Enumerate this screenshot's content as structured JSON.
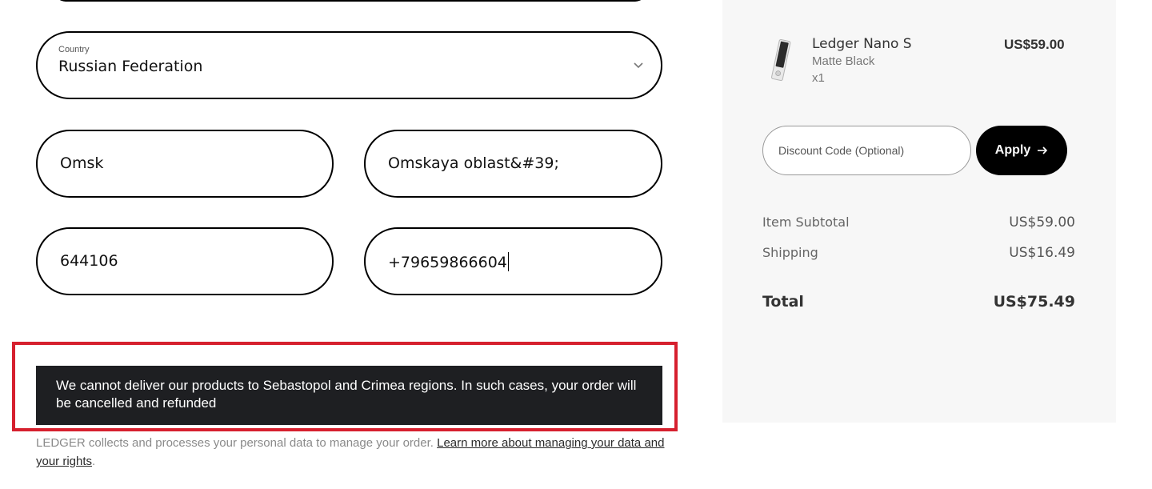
{
  "address_form": {
    "country": {
      "caption": "Country",
      "value": "Russian Federation"
    },
    "city": {
      "value": "Omsk"
    },
    "region": {
      "value": "Omskaya oblast&#39;"
    },
    "postal_code": {
      "value": "644106"
    },
    "phone": {
      "value": "+79659866604"
    }
  },
  "delivery_notice": "We cannot deliver our products to Sebastopol and Crimea regions. In such cases, your order will be cancelled and refunded",
  "privacy": {
    "text": "LEDGER collects and processes your personal data to manage your order.",
    "link_text": "Learn more about managing your data and your rights",
    "trailing": "."
  },
  "order_summary": {
    "product": {
      "name": "Ledger Nano S",
      "variant": "Matte Black",
      "quantity": "x1",
      "price": "US$59.00"
    },
    "discount": {
      "placeholder": "Discount Code (Optional)",
      "apply_label": "Apply"
    },
    "subtotal": {
      "label": "Item Subtotal",
      "amount": "US$59.00"
    },
    "shipping": {
      "label": "Shipping",
      "amount": "US$16.49"
    },
    "total": {
      "label": "Total",
      "amount": "US$75.49"
    }
  },
  "colors": {
    "highlight_border": "#d6202e",
    "notice_background": "#1e1f22",
    "summary_background": "#f7f7f7"
  },
  "icons": [
    "chevron-down-icon",
    "arrow-right-icon"
  ]
}
